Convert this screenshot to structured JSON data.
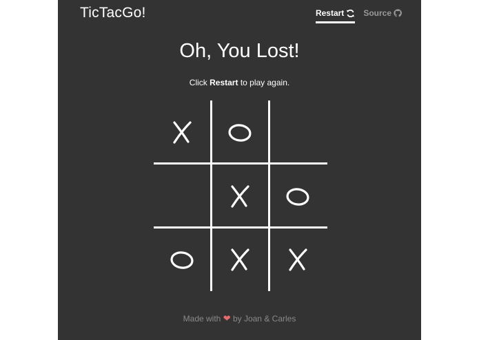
{
  "header": {
    "brand": "TicTacGo!",
    "nav": [
      {
        "label": "Restart",
        "icon": "refresh-icon",
        "active": true
      },
      {
        "label": "Source",
        "icon": "github-icon",
        "active": false
      }
    ]
  },
  "result": {
    "title": "Oh, You Lost!",
    "subtitle_pre": "Click ",
    "subtitle_bold": "Restart",
    "subtitle_post": " to play again."
  },
  "board": {
    "cells": [
      "X",
      "O",
      "",
      "",
      "X",
      "O",
      "O",
      "X",
      "X"
    ]
  },
  "footer": {
    "pre": "Made with",
    "heart": "❤",
    "post": "by Joan & Carles"
  },
  "colors": {
    "background": "#333333",
    "foreground": "#ffffff",
    "muted": "#9a9a9a",
    "heart": "#e66b6b"
  }
}
